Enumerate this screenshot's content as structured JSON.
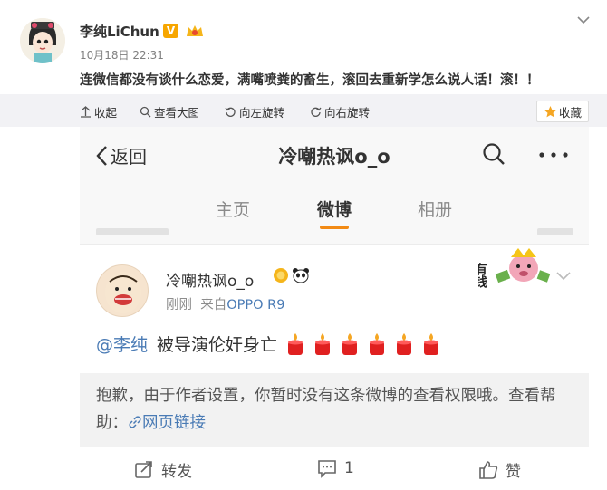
{
  "post": {
    "username": "李纯LiChun",
    "vip_badge": "V",
    "time": "10月18日 22:31",
    "text": "连微信都没有谈什么恋爱，满嘴喷粪的畜生，滚回去重新学怎么说人话！滚！！"
  },
  "toolbar": {
    "collapse": "收起",
    "view_large": "查看大图",
    "rotate_left": "向左旋转",
    "rotate_right": "向右旋转",
    "favorite": "收藏"
  },
  "screenshot": {
    "nav": {
      "back_label": "返回",
      "title": "冷嘲热讽o_o"
    },
    "tabs": [
      {
        "label": "主页"
      },
      {
        "label": "微博"
      },
      {
        "label": "相册"
      }
    ],
    "card": {
      "name": "冷嘲热讽o_o",
      "time": "刚刚",
      "source_prefix": "来自",
      "source": "OPPO R9",
      "mention": "@李纯",
      "text": "被导演伦奸身亡",
      "sticker_text": "有钱"
    },
    "notice": {
      "text": "抱歉，由于作者设置，你暂时没有这条微博的查看权限哦。查看帮助：",
      "link": "网页链接"
    },
    "actions": {
      "repost": "转发",
      "comment_count": "1",
      "like": "赞"
    }
  },
  "colors": {
    "link": "#4a7bb5",
    "tab_accent": "#f28a14",
    "vip": "#f7a600",
    "candle": "#e02020"
  }
}
